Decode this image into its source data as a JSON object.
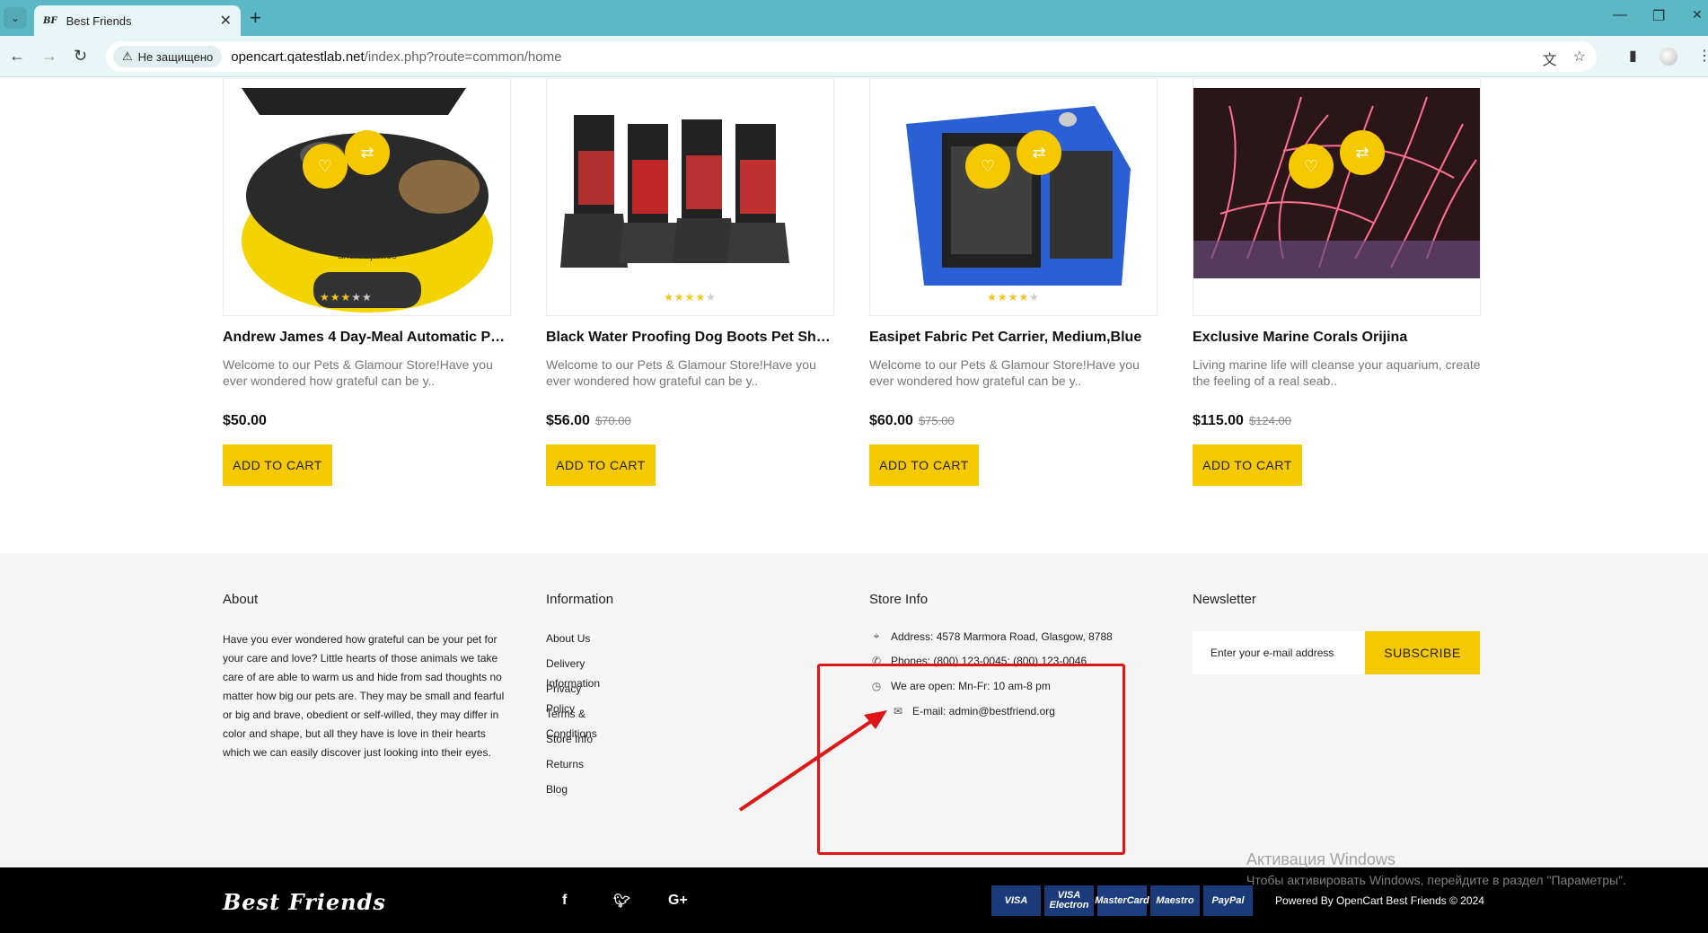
{
  "browser": {
    "tab_title": "Best Friends",
    "tab_favicon": "BF",
    "security_label": "Не защищено",
    "url_host": "opencart.qatestlab.net",
    "url_path": "/index.php?route=common/home"
  },
  "products": [
    {
      "title": "Andrew James 4 Day-Meal Automatic Pet ...",
      "desc": "Welcome to our Pets & Glamour Store!Have you ever wondered how grateful can be y..",
      "price": "$50.00",
      "old_price": "",
      "rating": 3,
      "cart": "ADD TO CART"
    },
    {
      "title": "Black Water Proofing Dog Boots Pet Shoes...",
      "desc": "Welcome to our Pets & Glamour Store!Have you ever wondered how grateful can be y..",
      "price": "$56.00",
      "old_price": "$70.00",
      "rating": 4,
      "cart": "ADD TO CART"
    },
    {
      "title": "Easipet Fabric Pet Carrier, Medium,Blue",
      "desc": "Welcome to our Pets & Glamour Store!Have you ever wondered how grateful can be y..",
      "price": "$60.00",
      "old_price": "$75.00",
      "rating": 4,
      "cart": "ADD TO CART"
    },
    {
      "title": "Exclusive Marine Corals Orijina",
      "desc": "Living marine life will cleanse your aquarium, create the feeling of a real seab..",
      "price": "$115.00",
      "old_price": "$124.00",
      "rating": 0,
      "cart": "ADD TO CART"
    }
  ],
  "footer": {
    "about": {
      "heading": "About",
      "text": "Have you ever wondered how grateful can be your pet for your care and love? Little hearts of those animals we take care of are able to warm us and hide from sad thoughts no matter how big our pets are. They may be small and fearful or big and brave, obedient or self-willed, they may differ in color and shape, but all they have is love in their hearts which we can easily discover just looking into their eyes."
    },
    "information": {
      "heading": "Information",
      "links": [
        "About Us",
        "Delivery Information",
        "Privacy Policy",
        "Terms & Conditions",
        "Store Info",
        "Returns",
        "Blog"
      ]
    },
    "store_info": {
      "heading": "Store Info",
      "address": "Address: 4578 Marmora Road, Glasgow, 8788",
      "phones": "Phones: (800) 123-0045; (800) 123-0046",
      "hours": "We are open: Mn-Fr: 10 am-8 pm",
      "email": "E-mail: admin@bestfriend.org"
    },
    "newsletter": {
      "heading": "Newsletter",
      "placeholder": "Enter your e-mail address",
      "button": "SUBSCRIBE"
    }
  },
  "bottom": {
    "logo": "Best Friends",
    "cards": [
      "VISA",
      "VISA Electron",
      "MasterCard",
      "Maestro",
      "PayPal"
    ],
    "powered": "Powered By OpenCart Best Friends © 2024"
  },
  "watermark": {
    "line1": "Активация Windows",
    "line2": "Чтобы активировать Windows, перейдите в раздел \"Параметры\"."
  },
  "colors": {
    "accent": "#f5c800",
    "tabbar": "#5bb8c4",
    "highlight": "#e01515"
  }
}
